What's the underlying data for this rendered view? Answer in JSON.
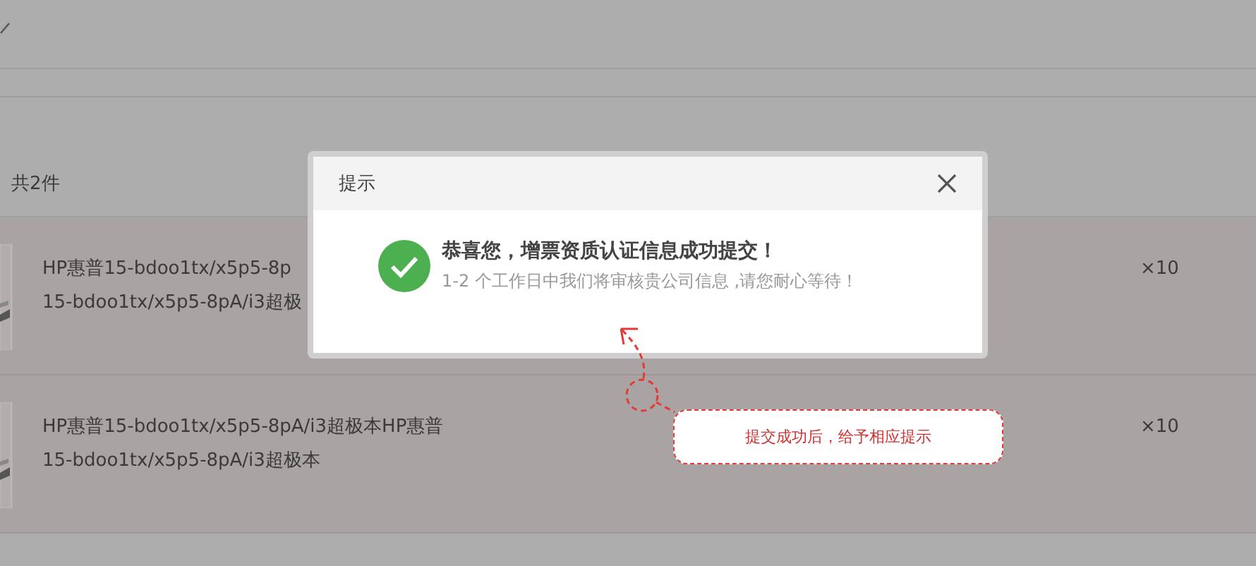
{
  "summary": "共2件",
  "items": [
    {
      "title_lines": [
        "HP惠普15-bdoo1tx/x5p5-8p",
        "15-bdoo1tx/x5p5-8pA/i3超极"
      ],
      "quantity": "×10"
    },
    {
      "title_lines": [
        "HP惠普15-bdoo1tx/x5p5-8pA/i3超极本HP惠普",
        "15-bdoo1tx/x5p5-8pA/i3超极本"
      ],
      "quantity": "×10"
    }
  ],
  "dialog": {
    "title": "提示",
    "message": "恭喜您，增票资质认证信息成功提交！",
    "detail": "1-2 个工作日中我们将审核贵公司信息 ,请您耐心等待！"
  },
  "annotation": {
    "text": "提交成功后，给予相应提示"
  }
}
